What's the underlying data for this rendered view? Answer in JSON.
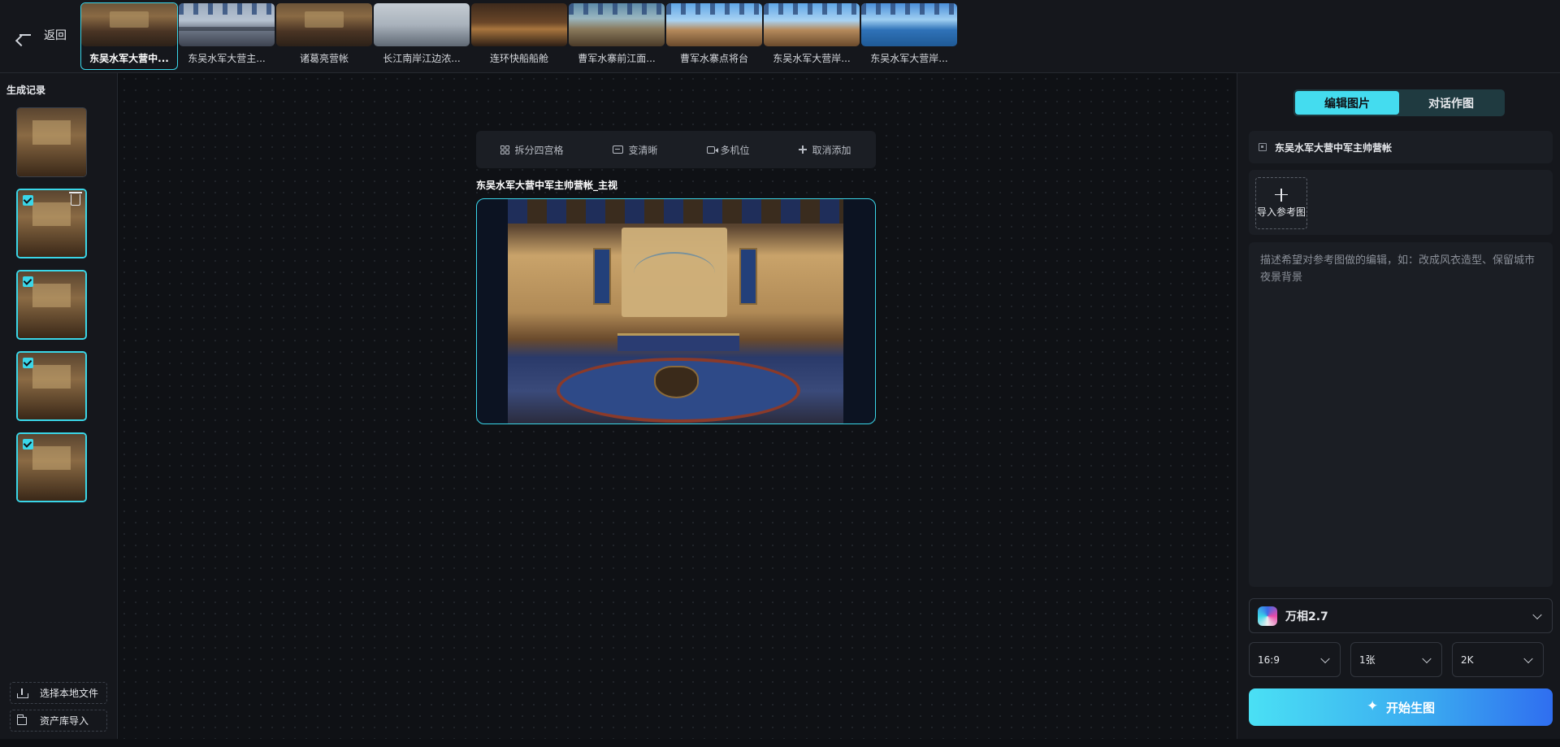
{
  "topbar": {
    "back_label": "返回",
    "scenes": [
      {
        "label": "东吴水军大营中...",
        "style": "tent",
        "active": true
      },
      {
        "label": "东吴水军大营主...",
        "style": "harbor",
        "active": false
      },
      {
        "label": "诸葛亮营帐",
        "style": "tent",
        "active": false
      },
      {
        "label": "长江南岸江边浓...",
        "style": "fog",
        "active": false
      },
      {
        "label": "连环快船船舱",
        "style": "cabin",
        "active": false
      },
      {
        "label": "曹军水寨前江面...",
        "style": "river",
        "active": false
      },
      {
        "label": "曹军水寨点将台",
        "style": "pier",
        "active": false
      },
      {
        "label": "东吴水军大营岸...",
        "style": "pier",
        "active": false
      },
      {
        "label": "东吴水军大营岸...",
        "style": "sea",
        "active": false
      }
    ]
  },
  "left": {
    "title": "生成记录",
    "history": [
      {
        "selected": false
      },
      {
        "selected": true,
        "trash": true
      },
      {
        "selected": true
      },
      {
        "selected": true
      },
      {
        "selected": true
      }
    ],
    "local_file_label": "选择本地文件",
    "asset_import_label": "资产库导入"
  },
  "canvas": {
    "tools": [
      {
        "label": "拆分四宫格",
        "icon": "grid-icon"
      },
      {
        "label": "变清晰",
        "icon": "hd-icon"
      },
      {
        "label": "多机位",
        "icon": "camera-icon"
      },
      {
        "label": "取消添加",
        "icon": "plus-icon"
      }
    ],
    "image_title": "东吴水军大营中军主帅营帐_主视"
  },
  "right": {
    "tabs": [
      {
        "label": "编辑图片",
        "active": true
      },
      {
        "label": "对话作图",
        "active": false
      }
    ],
    "scene_name": "东吴水军大营中军主帅营帐",
    "import_ref_label": "导入参考图",
    "prompt_placeholder": "描述希望对参考图做的编辑，如：改成风衣造型、保留城市夜景背景",
    "prompt_value": "",
    "model_name": "万相2.7",
    "aspect_ratio": "16:9",
    "count": "1张",
    "resolution": "2K",
    "generate_label": "开始生图"
  },
  "colors": {
    "accent": "#3ad6e8",
    "tab_active": "#44dcef",
    "generate_start": "#4ae0f4",
    "generate_end": "#2f6ef0"
  }
}
